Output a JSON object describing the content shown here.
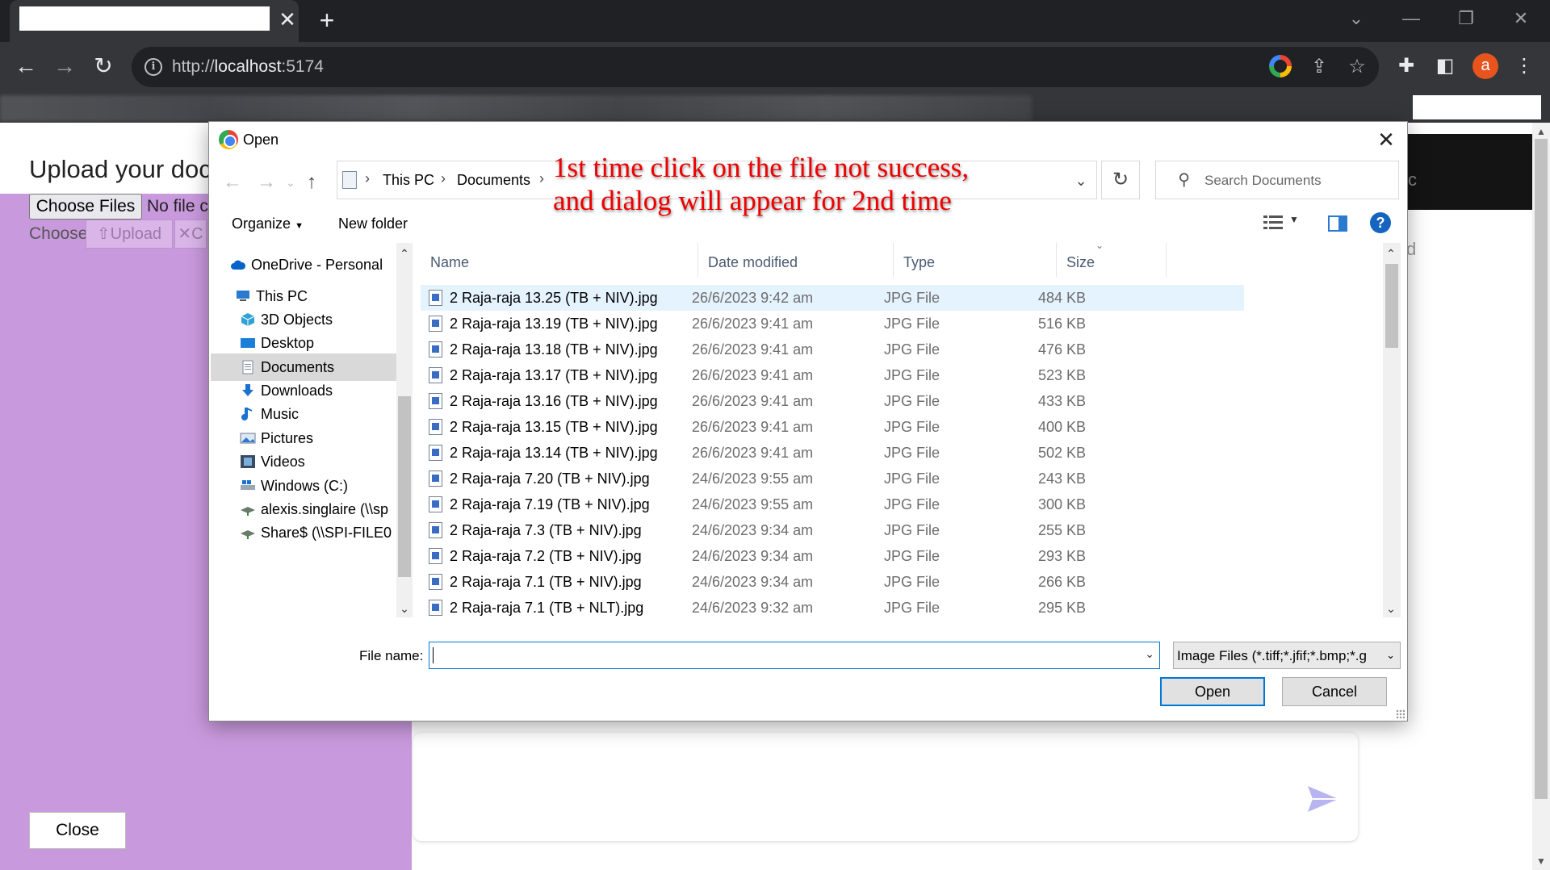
{
  "browser": {
    "tab_close": "✕",
    "new_tab": "+",
    "url_scheme": "http://",
    "url_host": "localhost",
    "url_port": ":5174",
    "avatar_letter": "a"
  },
  "page": {
    "title": "Upload your doc",
    "choose_files_label": "Choose Files",
    "no_file_text": "No file c",
    "choose_text": "Choose",
    "upload_label": "⇧Upload",
    "cancel_x_label": "✕C",
    "close_label": "Close",
    "dark_box_text": "c",
    "faint_text": "d"
  },
  "dialog": {
    "title": "Open",
    "close": "✕",
    "breadcrumb": [
      "This PC",
      "Documents"
    ],
    "search_placeholder": "Search Documents",
    "organize_label": "Organize",
    "new_folder_label": "New folder",
    "annotation_line1": "1st time click on the file not success,",
    "annotation_line2": "and dialog will appear for 2nd time",
    "nav_items": [
      {
        "label": "OneDrive - Personal",
        "icon": "cloud-icon"
      },
      {
        "label": "This PC",
        "icon": "computer-icon"
      },
      {
        "label": "3D Objects",
        "icon": "cube-icon"
      },
      {
        "label": "Desktop",
        "icon": "desktop-icon"
      },
      {
        "label": "Documents",
        "icon": "documents-icon",
        "selected": true
      },
      {
        "label": "Downloads",
        "icon": "download-icon"
      },
      {
        "label": "Music",
        "icon": "music-icon"
      },
      {
        "label": "Pictures",
        "icon": "pictures-icon"
      },
      {
        "label": "Videos",
        "icon": "videos-icon"
      },
      {
        "label": "Windows (C:)",
        "icon": "drive-icon"
      },
      {
        "label": "alexis.singlaire (\\\\sp",
        "icon": "network-drive-icon"
      },
      {
        "label": "Share$ (\\\\SPI-FILE0",
        "icon": "network-drive-icon"
      }
    ],
    "columns": [
      "Name",
      "Date modified",
      "Type",
      "Size"
    ],
    "files": [
      {
        "name": "2 Raja-raja 13.25 (TB + NIV).jpg",
        "date": "26/6/2023 9:42 am",
        "type": "JPG File",
        "size": "484 KB"
      },
      {
        "name": "2 Raja-raja 13.19 (TB + NIV).jpg",
        "date": "26/6/2023 9:41 am",
        "type": "JPG File",
        "size": "516 KB"
      },
      {
        "name": "2 Raja-raja 13.18 (TB + NIV).jpg",
        "date": "26/6/2023 9:41 am",
        "type": "JPG File",
        "size": "476 KB"
      },
      {
        "name": "2 Raja-raja 13.17 (TB + NIV).jpg",
        "date": "26/6/2023 9:41 am",
        "type": "JPG File",
        "size": "523 KB"
      },
      {
        "name": "2 Raja-raja 13.16 (TB + NIV).jpg",
        "date": "26/6/2023 9:41 am",
        "type": "JPG File",
        "size": "433 KB"
      },
      {
        "name": "2 Raja-raja 13.15 (TB + NIV).jpg",
        "date": "26/6/2023 9:41 am",
        "type": "JPG File",
        "size": "400 KB"
      },
      {
        "name": "2 Raja-raja 13.14 (TB + NIV).jpg",
        "date": "26/6/2023 9:41 am",
        "type": "JPG File",
        "size": "502 KB"
      },
      {
        "name": "2 Raja-raja 7.20 (TB + NIV).jpg",
        "date": "24/6/2023 9:55 am",
        "type": "JPG File",
        "size": "243 KB"
      },
      {
        "name": "2 Raja-raja 7.19 (TB + NIV).jpg",
        "date": "24/6/2023 9:55 am",
        "type": "JPG File",
        "size": "300 KB"
      },
      {
        "name": "2 Raja-raja 7.3 (TB + NIV).jpg",
        "date": "24/6/2023 9:34 am",
        "type": "JPG File",
        "size": "255 KB"
      },
      {
        "name": "2 Raja-raja 7.2 (TB + NIV).jpg",
        "date": "24/6/2023 9:34 am",
        "type": "JPG File",
        "size": "293 KB"
      },
      {
        "name": "2 Raja-raja 7.1 (TB + NIV).jpg",
        "date": "24/6/2023 9:34 am",
        "type": "JPG File",
        "size": "266 KB"
      },
      {
        "name": "2 Raja-raja 7.1 (TB + NLT).jpg",
        "date": "24/6/2023 9:32 am",
        "type": "JPG File",
        "size": "295 KB"
      }
    ],
    "file_name_label": "File name:",
    "file_name_value": "",
    "filter_value": "Image Files (*.tiff;*.jfif;*.bmp;*.g",
    "open_label": "Open",
    "cancel_label": "Cancel"
  }
}
